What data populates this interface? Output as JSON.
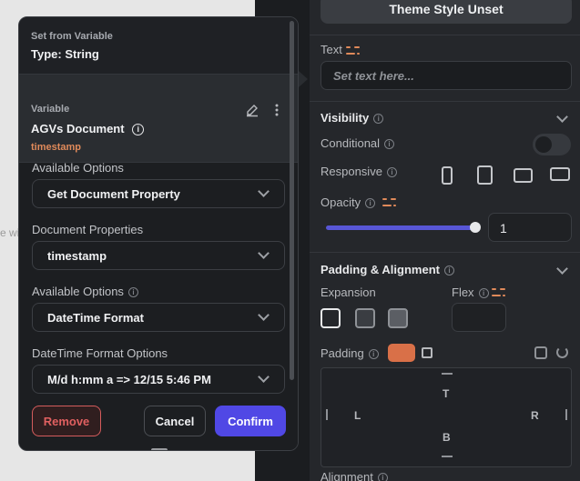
{
  "canvas": {
    "hint_text": "e wi"
  },
  "panel": {
    "theme_button": "Theme Style Unset",
    "text_label": "Text",
    "text_placeholder": "Set text here...",
    "visibility_title": "Visibility",
    "conditional_label": "Conditional",
    "responsive_label": "Responsive",
    "opacity_label": "Opacity",
    "opacity_value": "1",
    "opacity_level": 1.0,
    "padding_alignment_title": "Padding & Alignment",
    "expansion_label": "Expansion",
    "flex_label": "Flex",
    "padding_label": "Padding",
    "pad_top": "T",
    "pad_left": "L",
    "pad_right": "R",
    "pad_bottom": "B",
    "alignment_label": "Alignment",
    "conditional_enabled": false
  },
  "modal": {
    "header_small": "Set from Variable",
    "header_title": "Type: String",
    "variable_small": "Variable",
    "variable_name": "AGVs Document",
    "variable_field": "timestamp",
    "fields": [
      {
        "label": "Available Options",
        "value": "Get Document Property"
      },
      {
        "label": "Document Properties",
        "value": "timestamp"
      },
      {
        "label": "Available Options",
        "value": "DateTime Format"
      },
      {
        "label": "DateTime Format Options",
        "value": "M/d h:mm a => 12/15 5:46 PM"
      }
    ],
    "remove_label": "Remove",
    "cancel_label": "Cancel",
    "confirm_label": "Confirm"
  },
  "colors": {
    "accent": "#5048e5",
    "danger": "#e06060",
    "variable_accent": "#e08a5a"
  }
}
